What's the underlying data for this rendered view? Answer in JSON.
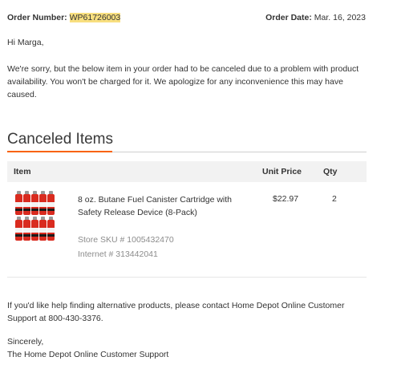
{
  "header": {
    "order_number_label": "Order Number:",
    "order_number": "WP61726003",
    "order_date_label": "Order Date:",
    "order_date": "Mar. 16, 2023"
  },
  "greeting": "Hi Marga,",
  "message": "We're sorry, but the below item in your order had to be canceled due to a problem with product availability. You won't be charged for it. We apologize for any inconvenience this may have caused.",
  "section": {
    "title": "Canceled Items"
  },
  "table": {
    "col_item": "Item",
    "col_unit_price": "Unit Price",
    "col_qty": "Qty"
  },
  "item": {
    "name": "8 oz. Butane Fuel Canister Cartridge with Safety Release Device (8-Pack)",
    "unit_price": "$22.97",
    "qty": "2",
    "store_sku": "Store SKU # 1005432470",
    "internet": "Internet # 313442041"
  },
  "help_text": "If you'd like help finding alternative products, please contact Home Depot Online Customer Support at 800-430-3376.",
  "signoff": "Sincerely,",
  "signature": "The Home Depot Online Customer Support",
  "colors": {
    "accent": "#f96302",
    "highlight": "#f8df7f",
    "header_bar": "#f2f2f2"
  }
}
